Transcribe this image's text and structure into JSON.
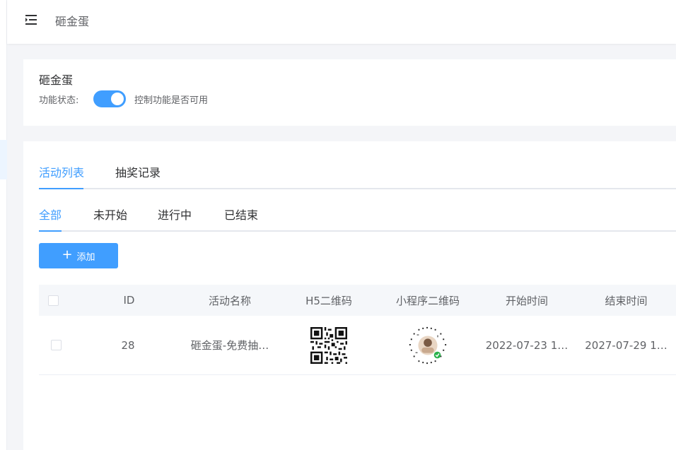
{
  "header": {
    "title": "砸金蛋",
    "menu_icon": "menu-fold-icon"
  },
  "status_card": {
    "title": "砸金蛋",
    "label": "功能状态:",
    "switch_on": true,
    "description": "控制功能是否可用",
    "accent": "#409eff"
  },
  "tabs": [
    {
      "label": "活动列表",
      "active": true
    },
    {
      "label": "抽奖记录",
      "active": false
    }
  ],
  "filters": [
    {
      "label": "全部",
      "active": true
    },
    {
      "label": "未开始",
      "active": false
    },
    {
      "label": "进行中",
      "active": false
    },
    {
      "label": "已结束",
      "active": false
    }
  ],
  "add_button": {
    "label": "添加",
    "icon": "plus-icon"
  },
  "table": {
    "columns": [
      "",
      "ID",
      "活动名称",
      "H5二维码",
      "小程序二维码",
      "开始时间",
      "结束时间"
    ],
    "rows": [
      {
        "id": "28",
        "name": "砸金蛋-免费抽…",
        "h5_qr": "qr-code-image",
        "mini_qr": "mini-program-code-image",
        "start": "2022-07-23 1…",
        "end": "2027-07-29 1…"
      }
    ]
  }
}
